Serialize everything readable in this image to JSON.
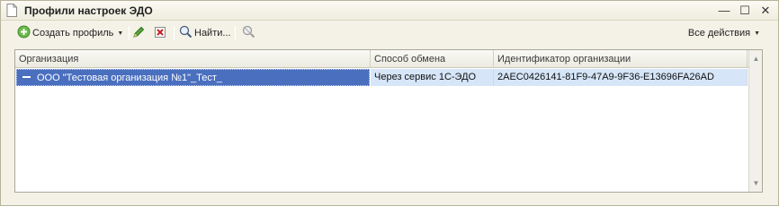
{
  "window": {
    "title": "Профили настроек ЭДО",
    "controls": {
      "minimize": "—",
      "maximize": "☐",
      "close": "✕"
    }
  },
  "toolbar": {
    "create_label": "Создать профиль",
    "find_label": "Найти...",
    "all_actions_label": "Все действия",
    "caret": "▼"
  },
  "table": {
    "columns": [
      "Организация",
      "Способ обмена",
      "Идентификатор организации"
    ],
    "rows": [
      {
        "organization": "ООО \"Тестовая организация №1\"_Тест_",
        "exchange_method": "Через сервис 1С-ЭДО",
        "org_id": "2AEC0426141-81F9-47A9-9F36-E13696FA26AD"
      }
    ],
    "scroll_up": "▲",
    "scroll_down": "▼"
  },
  "colors": {
    "selection": "#4a6fbf",
    "selection_light": "#d6e6f8",
    "window_bg": "#f4f2e7"
  }
}
